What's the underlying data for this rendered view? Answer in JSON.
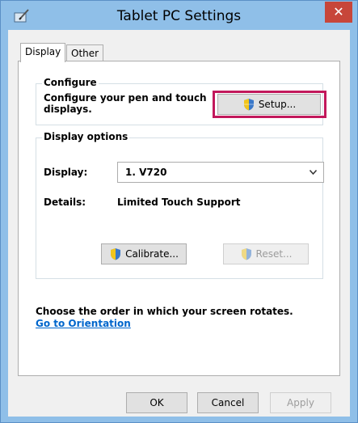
{
  "window": {
    "title": "Tablet PC Settings",
    "close_glyph": "✕"
  },
  "tabs": [
    {
      "label": "Display"
    },
    {
      "label": "Other"
    }
  ],
  "configure": {
    "group_label": "Configure",
    "description": "Configure your pen and touch displays.",
    "description_line1": "Configure your pen and touch",
    "description_line2": "displays.",
    "setup_label": "Setup..."
  },
  "display_options": {
    "group_label": "Display options",
    "display_label": "Display:",
    "display_value": "1. V720",
    "details_label": "Details:",
    "details_value": "Limited Touch Support",
    "calibrate_label": "Calibrate...",
    "reset_label": "Reset..."
  },
  "orientation": {
    "text": "Choose the order in which your screen rotates.",
    "link": "Go to Orientation"
  },
  "footer": {
    "ok": "OK",
    "cancel": "Cancel",
    "apply": "Apply"
  },
  "colors": {
    "highlight": "#c2185b",
    "link": "#0066cc",
    "titlebar": "#8fbfe8",
    "close": "#c7463a"
  },
  "icons": {
    "app": "tablet-pc-icon",
    "shield": "uac-shield-icon",
    "dropdown": "chevron-down-icon"
  }
}
